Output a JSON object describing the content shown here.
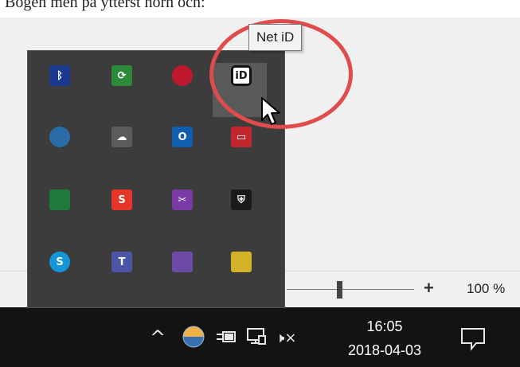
{
  "top_text": "Bogen men på ytterst hörn och:",
  "tooltip": {
    "text": "Net iD"
  },
  "statusbar": {
    "zoom_plus": "+",
    "zoom_level": "100 %"
  },
  "taskbar": {
    "chevron": "^",
    "volume_muted": "🕨×",
    "clock_time": "16:05",
    "clock_date": "2018-04-03"
  },
  "tray_icons": [
    {
      "name": "bluetooth-icon",
      "glyph": "ᛒ",
      "color": "#1b3a8f"
    },
    {
      "name": "sync-warning-icon",
      "glyph": "⟳",
      "color": "#2d8a3a"
    },
    {
      "name": "red-ball-icon",
      "glyph": "",
      "color": "#c0182e"
    },
    {
      "name": "net-id-icon",
      "glyph": "iD",
      "color": "#ffffff"
    },
    {
      "name": "globe-sync-icon",
      "glyph": "",
      "color": "#2a6ca8"
    },
    {
      "name": "onedrive-icon",
      "glyph": "☁",
      "color": "#5c5c5c"
    },
    {
      "name": "outlook-icon",
      "glyph": "O",
      "color": "#0f5fb0"
    },
    {
      "name": "oracle-icon",
      "glyph": "▭",
      "color": "#c4262e"
    },
    {
      "name": "remote-desktop-icon",
      "glyph": "",
      "color": "#1e7a3a"
    },
    {
      "name": "snagit-icon",
      "glyph": "S",
      "color": "#e8352a"
    },
    {
      "name": "onenote-clipper-icon",
      "glyph": "✂",
      "color": "#7a3aa6"
    },
    {
      "name": "defender-shield-icon",
      "glyph": "⛨",
      "color": "#1a1a1a"
    },
    {
      "name": "skype-icon",
      "glyph": "S",
      "color": "#1296d6"
    },
    {
      "name": "teams-icon",
      "glyph": "T",
      "color": "#4d55a7"
    },
    {
      "name": "error-app-icon",
      "glyph": "",
      "color": "#6b4aa8"
    },
    {
      "name": "security-badge-icon",
      "glyph": "",
      "color": "#d4b227"
    }
  ]
}
